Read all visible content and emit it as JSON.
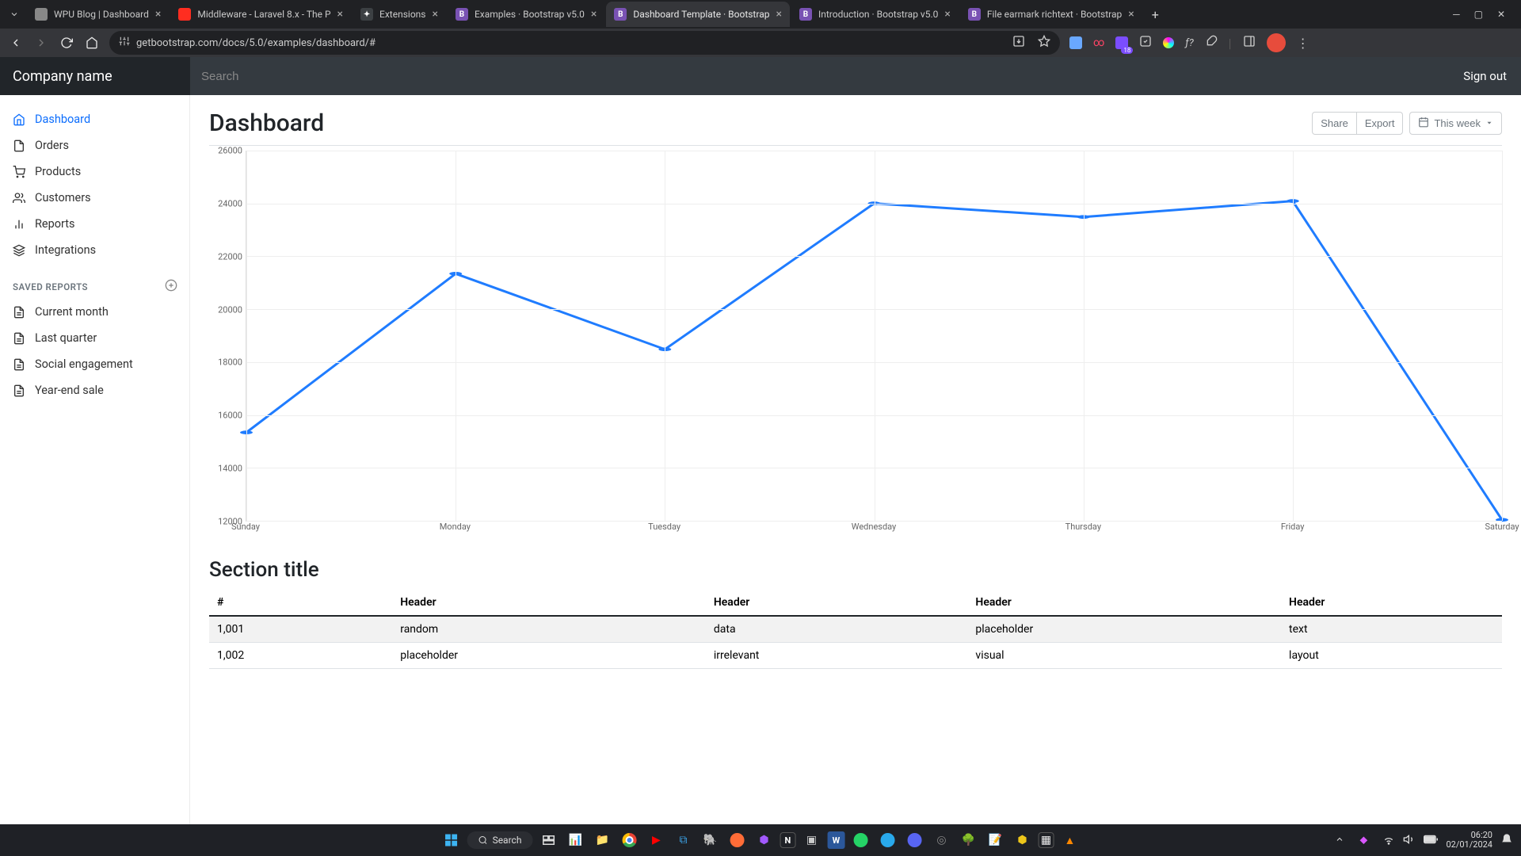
{
  "browser": {
    "url": "getbootstrap.com/docs/5.0/examples/dashboard/#",
    "tabs": [
      {
        "title": "WPU Blog | Dashboard",
        "fav_bg": "#888",
        "fav_text": ""
      },
      {
        "title": "Middleware - Laravel 8.x - The P",
        "fav_bg": "#ff2d20",
        "fav_text": ""
      },
      {
        "title": "Extensions",
        "fav_bg": "#3c4043",
        "fav_text": "✦"
      },
      {
        "title": "Examples · Bootstrap v5.0",
        "fav_bg": "#7952b3",
        "fav_text": "B"
      },
      {
        "title": "Dashboard Template · Bootstrap",
        "fav_bg": "#7952b3",
        "fav_text": "B"
      },
      {
        "title": "Introduction · Bootstrap v5.0",
        "fav_bg": "#7952b3",
        "fav_text": "B"
      },
      {
        "title": "File earmark richtext · Bootstrap",
        "fav_bg": "#7952b3",
        "fav_text": "B"
      }
    ],
    "active_tab": 4
  },
  "header": {
    "brand": "Company name",
    "search_placeholder": "Search",
    "signout": "Sign out"
  },
  "sidebar": {
    "items": [
      {
        "label": "Dashboard",
        "icon": "home"
      },
      {
        "label": "Orders",
        "icon": "file"
      },
      {
        "label": "Products",
        "icon": "cart"
      },
      {
        "label": "Customers",
        "icon": "users"
      },
      {
        "label": "Reports",
        "icon": "bars"
      },
      {
        "label": "Integrations",
        "icon": "layers"
      }
    ],
    "section_header": "SAVED REPORTS",
    "saved": [
      {
        "label": "Current month"
      },
      {
        "label": "Last quarter"
      },
      {
        "label": "Social engagement"
      },
      {
        "label": "Year-end sale"
      }
    ]
  },
  "main": {
    "title": "Dashboard",
    "share": "Share",
    "export": "Export",
    "thisweek": "This week",
    "section_title": "Section title"
  },
  "table": {
    "headers": [
      "#",
      "Header",
      "Header",
      "Header",
      "Header"
    ],
    "rows": [
      [
        "1,001",
        "random",
        "data",
        "placeholder",
        "text"
      ],
      [
        "1,002",
        "placeholder",
        "irrelevant",
        "visual",
        "layout"
      ]
    ]
  },
  "chart_data": {
    "type": "line",
    "categories": [
      "Sunday",
      "Monday",
      "Tuesday",
      "Wednesday",
      "Thursday",
      "Friday",
      "Saturday"
    ],
    "values": [
      15339,
      21345,
      18483,
      24003,
      23489,
      24092,
      12034
    ],
    "title": "",
    "xlabel": "",
    "ylabel": "",
    "ylim": [
      12000,
      26000
    ],
    "yticks": [
      12000,
      14000,
      16000,
      18000,
      20000,
      22000,
      24000,
      26000
    ],
    "color": "#1f7cff"
  },
  "taskbar": {
    "search_label": "Search",
    "time": "06:20",
    "date": "02/01/2024"
  }
}
